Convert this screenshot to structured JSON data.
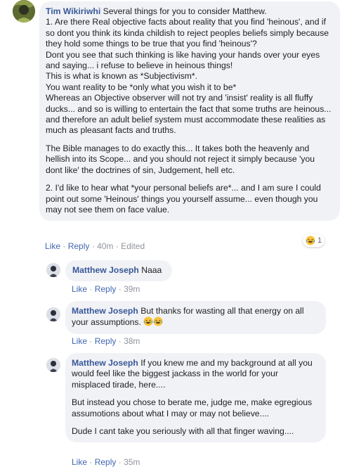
{
  "comments": [
    {
      "author": "Tim Wikiriwhi",
      "paragraphs": [
        "Several things for you to consider Matthew.\n1. Are there Real objective facts about reality that you find 'heinous', and if so dont you think its kinda childish to reject peoples beliefs simply because they hold some things to be true that you find 'heinous'?\nDont you see that such thinking is like having your hands over your eyes and saying... i refuse to believe in heinous things!\nThis is what is known as *Subjectivism*.\nYou want reality to be *only what you wish it to be*\nWhereas an Objective observer will not try and 'insist' reality is all fluffy ducks... and so is willing to entertain the fact that some truths are heinous... and therefore an adult belief system must accommodate these realities as much as pleasant facts and truths.",
        "The Bible manages to do exactly this... It takes both the heavenly and hellish into its Scope... and you should not reject it simply because 'you dont like' the doctrines of sin, Judgement, hell etc.",
        "2. I'd like to hear what *your personal beliefs are*... and I am sure I could point out some 'Heinous' things you yourself assume... even though you may not see them on face value."
      ],
      "like_label": "Like",
      "reply_label": "Reply",
      "time": "40m",
      "edited_label": "Edited",
      "reaction_count": "1"
    },
    {
      "author": "Matthew Joseph",
      "text": "Naaa",
      "like_label": "Like",
      "reply_label": "Reply",
      "time": "39m"
    },
    {
      "author": "Matthew Joseph",
      "text": "But thanks for wasting all that energy on all your assumptions.",
      "like_label": "Like",
      "reply_label": "Reply",
      "time": "38m"
    },
    {
      "author": "Matthew Joseph",
      "paragraphs": [
        "If you knew me and my background at all you would feel like the biggest jackass in the world for your misplaced tirade, here....",
        "But instead you chose to berate me, judge me, make egregious assumotions about what I may or may not believe....",
        "Dude I cant take you seriously with all that finger waving...."
      ],
      "like_label": "Like",
      "reply_label": "Reply",
      "time": "35m"
    }
  ],
  "separator": "·",
  "icons": {
    "laugh": "laughing-emoji-icon"
  },
  "colors": {
    "name": "#385898",
    "link": "#4267b2",
    "bubble": "#f0f2f5",
    "meta": "#90949c"
  }
}
